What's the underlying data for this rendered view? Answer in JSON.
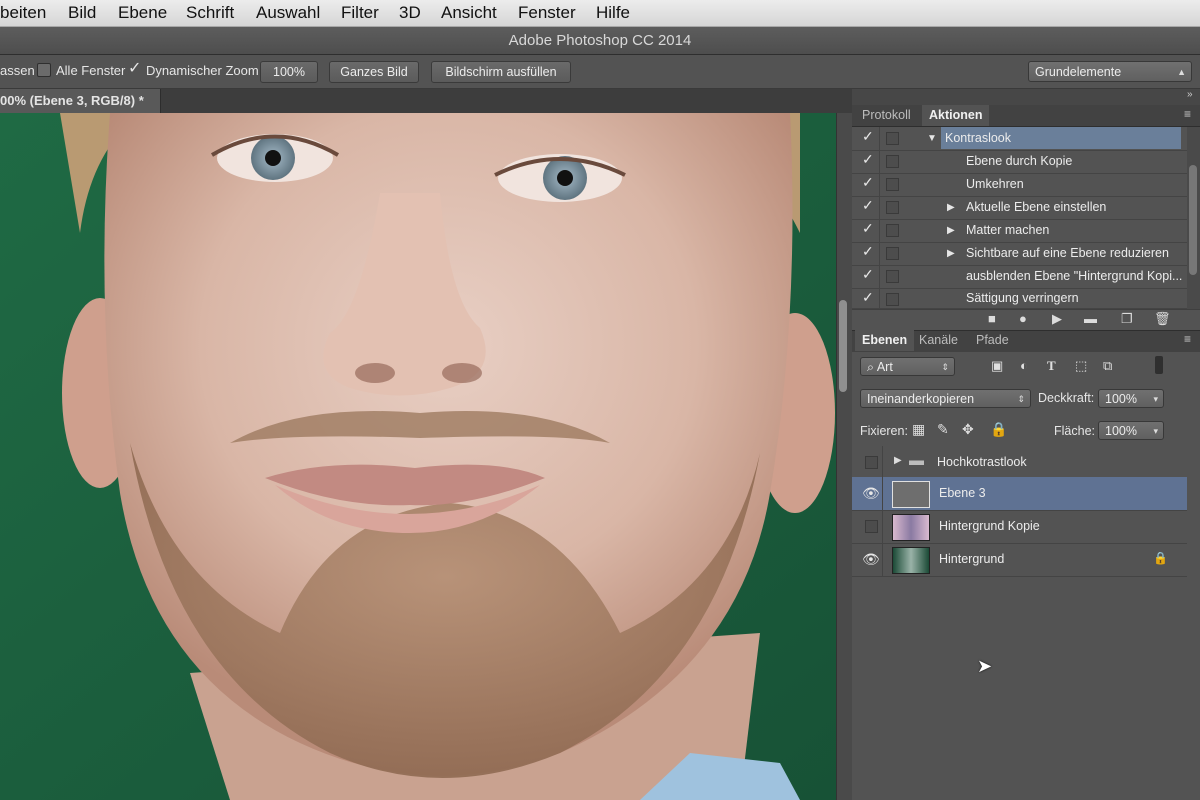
{
  "menubar": {
    "items": [
      "beiten",
      "Bild",
      "Ebene",
      "Schrift",
      "Auswahl",
      "Filter",
      "3D",
      "Ansicht",
      "Fenster",
      "Hilfe"
    ]
  },
  "window": {
    "title": "Adobe Photoshop CC 2014"
  },
  "options": {
    "cut_text": "assen",
    "all_windows_label": "Alle Fenster",
    "all_windows_checked": false,
    "dynamic_zoom_label": "Dynamischer Zoom",
    "dynamic_zoom_checked": true,
    "zoom_value": "100%",
    "fit_button": "Ganzes Bild",
    "fill_button": "Bildschirm ausfüllen",
    "workspace": "Grundelemente"
  },
  "document": {
    "tab_title": "00% (Ebene 3, RGB/8) *"
  },
  "actions_panel": {
    "tabs": [
      "Protokoll",
      "Aktionen"
    ],
    "active_tab": "Aktionen",
    "items": [
      {
        "label": "Kontraslook",
        "checked": true,
        "expanded": true,
        "level": 0,
        "selected": true
      },
      {
        "label": "Ebene durch Kopie",
        "checked": true,
        "expandable": false,
        "level": 1
      },
      {
        "label": "Umkehren",
        "checked": true,
        "expandable": false,
        "level": 1
      },
      {
        "label": "Aktuelle Ebene einstellen",
        "checked": true,
        "expandable": true,
        "level": 1
      },
      {
        "label": "Matter machen",
        "checked": true,
        "expandable": true,
        "level": 1
      },
      {
        "label": "Sichtbare auf eine Ebene reduzieren",
        "checked": true,
        "expandable": true,
        "level": 1
      },
      {
        "label": "ausblenden Ebene \"Hintergrund Kopi...",
        "checked": true,
        "expandable": false,
        "level": 1
      },
      {
        "label": "Sättigung verringern",
        "checked": true,
        "expandable": false,
        "level": 1
      }
    ]
  },
  "layers_panel": {
    "tabs": [
      "Ebenen",
      "Kanäle",
      "Pfade"
    ],
    "active_tab": "Ebenen",
    "filter_kind": "Art",
    "blend_mode": "Ineinanderkopieren",
    "opacity_label": "Deckkraft:",
    "opacity": "100%",
    "lock_label": "Fixieren:",
    "fill_label": "Fläche:",
    "fill": "100%",
    "layers": [
      {
        "name": "Hochkotrastlook",
        "type": "group",
        "visible": false,
        "selected": false
      },
      {
        "name": "Ebene 3",
        "type": "layer",
        "visible": true,
        "selected": true
      },
      {
        "name": "Hintergrund Kopie",
        "type": "layer",
        "visible": false,
        "selected": false
      },
      {
        "name": "Hintergrund",
        "type": "layer",
        "visible": true,
        "selected": false,
        "locked": true
      }
    ]
  },
  "colors": {
    "canvas_background": "#1f5d3c",
    "selection_highlight": "#5f7293",
    "ui_panel": "#535353"
  }
}
